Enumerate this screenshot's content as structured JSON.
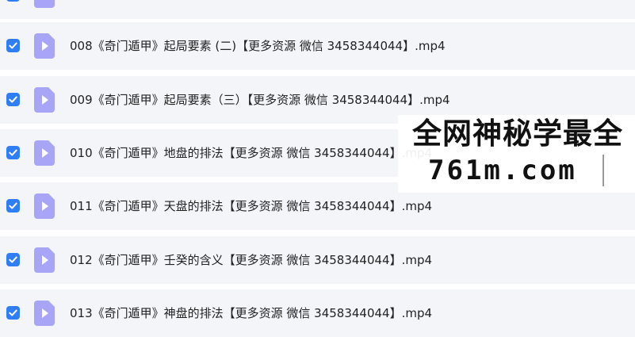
{
  "files": [
    {
      "name": "",
      "checked": true
    },
    {
      "name": "008《奇门遁甲》起局要素 (二)【更多资源 微信 3458344044】.mp4",
      "checked": true
    },
    {
      "name": "009《奇门遁甲》起局要素（三）【更多资源 微信 3458344044】.mp4",
      "checked": true
    },
    {
      "name": "010《奇门遁甲》地盘的排法【更多资源 微信 3458344044】.mp4",
      "checked": true
    },
    {
      "name": "011《奇门遁甲》天盘的排法【更多资源 微信 3458344044】.mp4",
      "checked": true
    },
    {
      "name": "012《奇门遁甲》壬癸的含义【更多资源 微信 3458344044】.mp4",
      "checked": true
    },
    {
      "name": "013《奇门遁甲》神盘的排法【更多资源 微信 3458344044】.mp4",
      "checked": true
    }
  ],
  "watermark": {
    "line1": "全网神秘学最全",
    "line2": "761m.com"
  },
  "colors": {
    "checkbox": "#2f7ef5",
    "file_icon": "#a8a4f6",
    "row_background": "#f4f5f9",
    "separator": "#ffffff"
  },
  "icons": {
    "checkbox": "check-icon",
    "file": "video-file-icon"
  }
}
